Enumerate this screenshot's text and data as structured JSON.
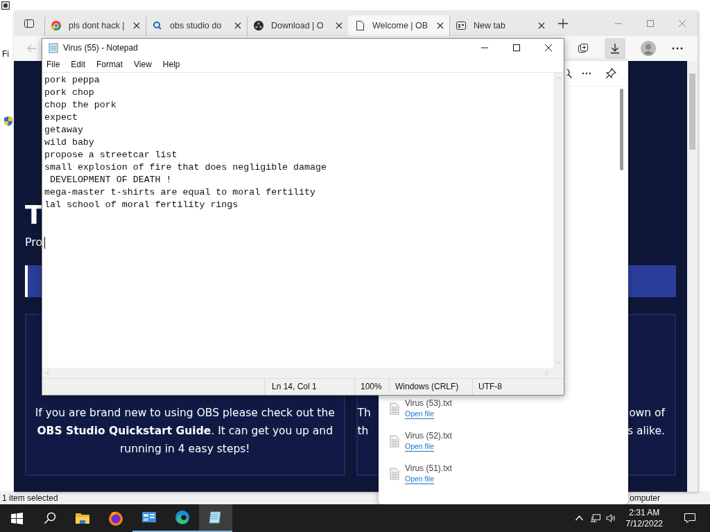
{
  "background_window": {
    "menu_fragment": "Fi",
    "status": "1 item selected",
    "status_right": "omputer"
  },
  "browser": {
    "tabs": [
      {
        "label": "pls dont hack |",
        "selected": false
      },
      {
        "label": "obs studio do",
        "selected": false
      },
      {
        "label": "Download | O",
        "selected": false
      },
      {
        "label": "Welcome | OB",
        "selected": true
      },
      {
        "label": "New tab",
        "selected": false
      }
    ],
    "page": {
      "heading_fragment": "T",
      "subtitle_fragment": "Pro",
      "left_card": "If you are brand new to using OBS please check out the **OBS Studio Quickstart Guide**. It can get you up and running in 4 easy steps!",
      "right_card_left": [
        "Th",
        "th"
      ],
      "right_card_right": [
        "own of",
        "s alike."
      ]
    },
    "downloads": [
      {
        "file": "Virus (53).txt",
        "action": "Open file"
      },
      {
        "file": "Virus (52).txt",
        "action": "Open file"
      },
      {
        "file": "Virus (51).txt",
        "action": "Open file"
      }
    ]
  },
  "notepad": {
    "title": "Virus (55) - Notepad",
    "menu": [
      "File",
      "Edit",
      "Format",
      "View",
      "Help"
    ],
    "lines": [
      "pork peppa",
      "pork chop",
      "chop the pork",
      "expect",
      "getaway",
      "wild baby",
      "propose a streetcar list",
      "small explosion of fire that does negligible damage",
      " DEVELOPMENT OF DEATH !",
      "mega-master t-shirts are equal to moral fertility",
      "lal school of moral fertility rings"
    ],
    "status": {
      "position": "Ln 14, Col 1",
      "zoom": "100%",
      "line_ending": "Windows (CRLF)",
      "encoding": "UTF-8"
    }
  },
  "taskbar": {
    "apps": [
      {
        "kind": "explorer",
        "running": false,
        "active": false
      },
      {
        "kind": "firefox",
        "running": false,
        "active": false
      },
      {
        "kind": "control",
        "running": true,
        "active": false
      },
      {
        "kind": "edge",
        "running": true,
        "active": false
      },
      {
        "kind": "notepad",
        "running": true,
        "active": true
      }
    ],
    "time": "2:31 AM",
    "date": "7/12/2022"
  }
}
